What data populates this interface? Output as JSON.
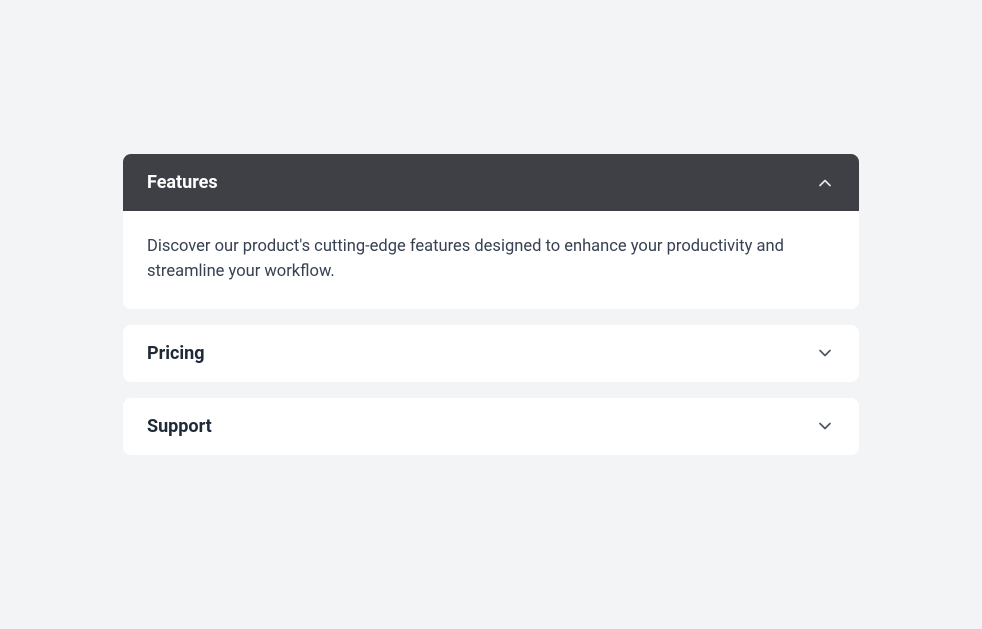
{
  "accordion": {
    "items": [
      {
        "title": "Features",
        "content": "Discover our product's cutting-edge features designed to enhance your productivity and streamline your workflow.",
        "expanded": true
      },
      {
        "title": "Pricing",
        "expanded": false
      },
      {
        "title": "Support",
        "expanded": false
      }
    ]
  }
}
